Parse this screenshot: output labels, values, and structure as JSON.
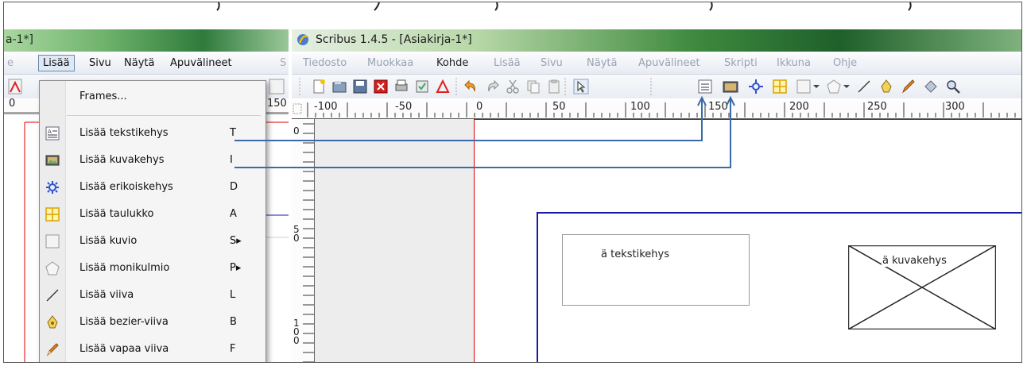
{
  "left_window": {
    "title": "a-1*]",
    "menu": {
      "items": [
        {
          "label": "e",
          "state": "dim"
        },
        {
          "label": "Lisää",
          "state": "active"
        },
        {
          "label": "Sivu",
          "state": "normal"
        },
        {
          "label": "Näytä",
          "state": "normal"
        },
        {
          "label": "Apuvälineet",
          "state": "normal"
        },
        {
          "label": "S",
          "state": "dim"
        }
      ]
    },
    "ruler": {
      "labels": [
        "0",
        "150"
      ]
    }
  },
  "dropdown": {
    "items": [
      {
        "label": "Frames...",
        "shortcut": "",
        "icon": "none"
      },
      {
        "label": "Lisää tekstikehys",
        "shortcut": "T",
        "icon": "text-frame-icon"
      },
      {
        "label": "Lisää kuvakehys",
        "shortcut": "I",
        "icon": "image-frame-icon"
      },
      {
        "label": "Lisää erikoiskehys",
        "shortcut": "D",
        "icon": "render-frame-icon"
      },
      {
        "label": "Lisää taulukko",
        "shortcut": "A",
        "icon": "table-icon"
      },
      {
        "label": "Lisää kuvio",
        "shortcut": "S▸",
        "icon": "shape-icon"
      },
      {
        "label": "Lisää monikulmio",
        "shortcut": "P▸",
        "icon": "polygon-icon"
      },
      {
        "label": "Lisää viiva",
        "shortcut": "L",
        "icon": "line-icon"
      },
      {
        "label": "Lisää bezier-viiva",
        "shortcut": "B",
        "icon": "bezier-icon"
      },
      {
        "label": "Lisää vapaa viiva",
        "shortcut": "F",
        "icon": "freehand-icon"
      }
    ]
  },
  "right_window": {
    "title": "Scribus 1.4.5 - [Asiakirja-1*]",
    "menu": {
      "items": [
        {
          "label": "Tiedosto",
          "strong": false
        },
        {
          "label": "Muokkaa",
          "strong": false
        },
        {
          "label": "Kohde",
          "strong": true
        },
        {
          "label": "Lisää",
          "strong": false
        },
        {
          "label": "Sivu",
          "strong": false
        },
        {
          "label": "Näytä",
          "strong": false
        },
        {
          "label": "Apuvälineet",
          "strong": false
        },
        {
          "label": "Skripti",
          "strong": false
        },
        {
          "label": "Ikkuna",
          "strong": false
        },
        {
          "label": "Ohje",
          "strong": false
        }
      ]
    },
    "toolbar": {
      "icons": [
        "new-document-icon",
        "open-icon",
        "save-icon",
        "close-icon",
        "print-icon",
        "preflight-icon",
        "pdf-export-icon",
        "undo-icon",
        "redo-icon",
        "cut-icon",
        "copy-icon",
        "paste-icon",
        "select-icon",
        "text-frame-icon",
        "image-frame-icon",
        "render-frame-icon",
        "table-icon",
        "shape-icon",
        "polygon-icon",
        "line-icon",
        "bezier-icon",
        "freehand-icon",
        "rotate-icon",
        "zoom-icon"
      ]
    },
    "ruler": {
      "labels": [
        "-100",
        "-50",
        "0",
        "50",
        "100",
        "150",
        "200",
        "250",
        "300"
      ]
    },
    "vruler": {
      "labels": [
        "0",
        "5\n0",
        "1\n0\n0"
      ]
    },
    "canvas": {
      "text_frame_label": "ä tekstikehys",
      "image_frame_label": "ä kuvakehys"
    }
  },
  "colors": {
    "page_margin": "#d00000",
    "guide": "#1a1aa8",
    "connector": "#3b6aa8"
  }
}
